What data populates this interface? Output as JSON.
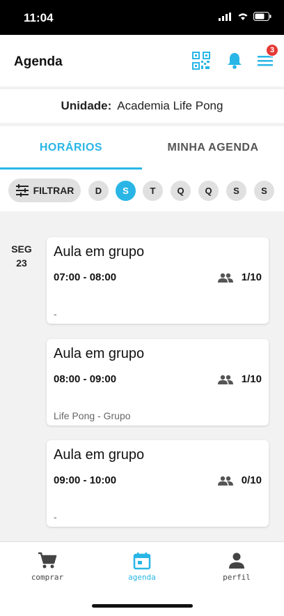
{
  "status": {
    "time": "11:04"
  },
  "header": {
    "title": "Agenda",
    "notification_count": "3",
    "icons": [
      "qr-code-icon",
      "bell-icon",
      "menu-icon"
    ],
    "accent": "#29b6e6"
  },
  "unit": {
    "label": "Unidade:",
    "value": "Academia Life Pong"
  },
  "tabs": [
    {
      "label": "HORÁRIOS",
      "active": true
    },
    {
      "label": "MINHA AGENDA",
      "active": false
    }
  ],
  "filter": {
    "label": "FILTRAR",
    "days": [
      "D",
      "S",
      "T",
      "Q",
      "Q",
      "S",
      "S"
    ],
    "active_day_index": 1
  },
  "date": {
    "weekday": "SEG",
    "day": "23"
  },
  "classes": [
    {
      "title": "Aula em grupo",
      "time": "07:00 - 08:00",
      "capacity": "1/10",
      "subtitle": "-"
    },
    {
      "title": "Aula em grupo",
      "time": "08:00 - 09:00",
      "capacity": "1/10",
      "subtitle": "Life Pong - Grupo"
    },
    {
      "title": "Aula em grupo",
      "time": "09:00 - 10:00",
      "capacity": "0/10",
      "subtitle": "-"
    }
  ],
  "bottom_nav": [
    {
      "label": "comprar",
      "icon": "cart-icon",
      "active": false
    },
    {
      "label": "agenda",
      "icon": "calendar-icon",
      "active": true
    },
    {
      "label": "perfil",
      "icon": "person-icon",
      "active": false
    }
  ]
}
